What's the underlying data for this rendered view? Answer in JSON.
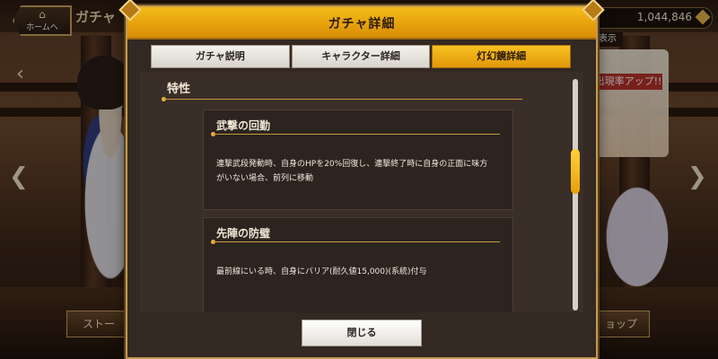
{
  "topbar": {
    "home_label": "ホームへ",
    "title": "ガチャ",
    "currency_value": "1,044,846",
    "show_label": "表示"
  },
  "background": {
    "banner_text": "出現率アップ!!",
    "bottom_left_label": "ストー",
    "bottom_right_label": "ョップ"
  },
  "modal": {
    "title": "ガチャ詳細",
    "tabs": [
      {
        "label": "ガチャ説明",
        "active": false
      },
      {
        "label": "キャラクター詳細",
        "active": false
      },
      {
        "label": "灯幻鏡詳細",
        "active": true
      }
    ],
    "section_heading": "特性",
    "skills": [
      {
        "title": "武撃の回勤",
        "description": "連撃武段発動時、自身のHPを20%回復し、連撃終了時に自身の正面に味方がいない場合、前列に移動"
      },
      {
        "title": "先陣の防璧",
        "description": "最前線にいる時、自身にバリア(耐久値15,000)(系統)付与"
      }
    ],
    "close_label": "閉じる"
  },
  "colors": {
    "header_gold": "#f4bc1c",
    "accent_line": "#c89a38",
    "panel_dark": "#2d2420",
    "scroll_thumb": "#ffd23a"
  }
}
